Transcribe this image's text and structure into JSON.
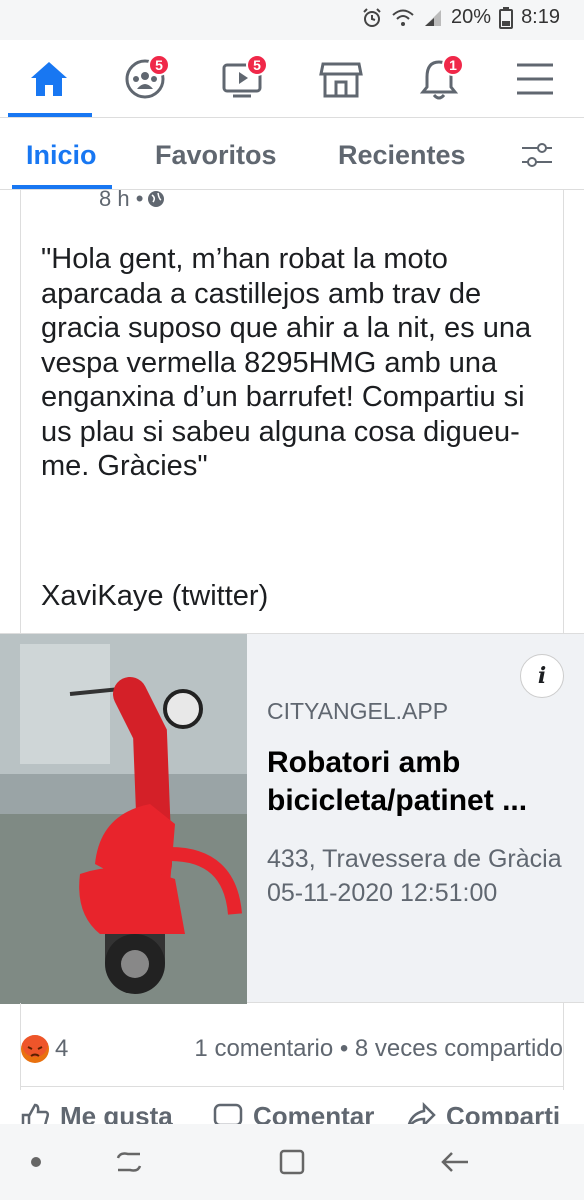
{
  "status_bar": {
    "battery": "20%",
    "time": "8:19"
  },
  "top_nav": {
    "groups_badge": "5",
    "watch_badge": "5",
    "notifications_badge": "1"
  },
  "feed_tabs": {
    "inicio": "Inicio",
    "favoritos": "Favoritos",
    "recientes": "Recientes"
  },
  "post": {
    "time": "8 h •",
    "text": "\"Hola gent, m’han robat la moto aparcada a castillejos amb trav de gracia suposo que ahir a la nit, es una vespa vermella 8295HMG amb una enganxina d’un barrufet! Compartiu si us plau si sabeu alguna cosa digueu-me. Gràcies\"",
    "credit": "XaviKaye (twitter)"
  },
  "link_preview": {
    "domain": "CITYANGEL.APP",
    "title": "Robatori amb bicicleta/patinet ...",
    "description": "433, Travessera de Gràcia 05-11-2020 12:51:00",
    "info_label": "i"
  },
  "engagement": {
    "reaction_count": "4",
    "summary": "1 comentario • 8 veces compartido"
  },
  "actions": {
    "like": "Me gusta",
    "comment": "Comentar",
    "share": "Comparti"
  },
  "colors": {
    "accent": "#1877f2",
    "badge": "#f02849",
    "scooter_red": "#e8242c"
  }
}
